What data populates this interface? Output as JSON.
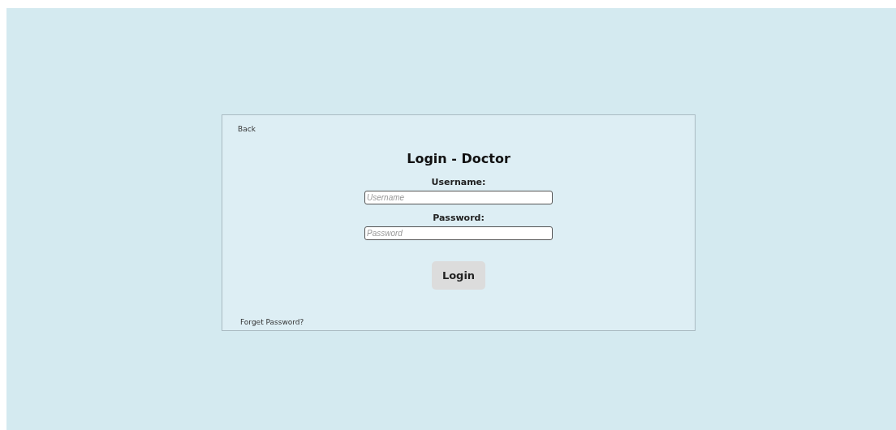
{
  "back_link": "Back",
  "title": "Login - Doctor",
  "fields": [
    {
      "label": "Username:",
      "placeholder": "Username"
    },
    {
      "label": "Password:",
      "placeholder": "Password"
    }
  ],
  "login_button": "Login",
  "forgot_link": "Forget Password?"
}
